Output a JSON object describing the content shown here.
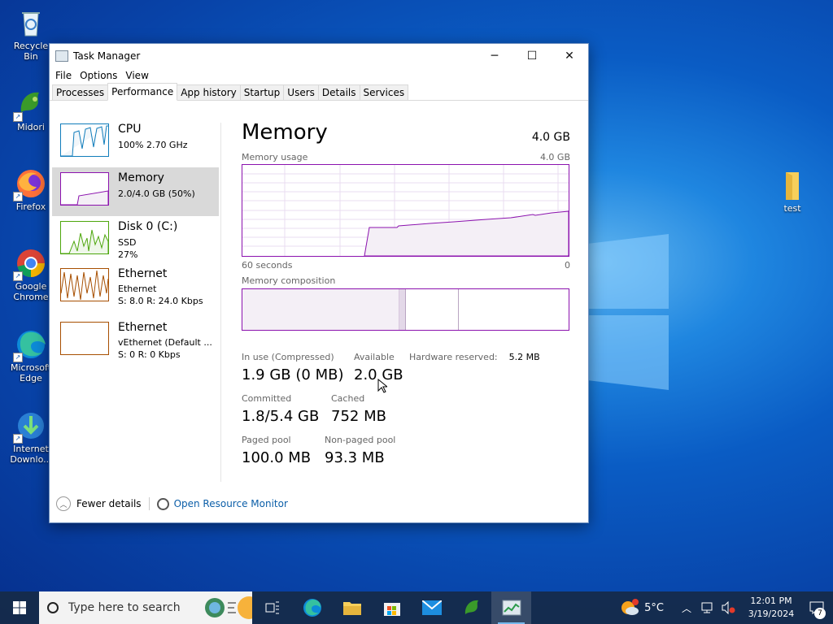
{
  "desktop": {
    "icons": [
      {
        "label": "Recycle Bin",
        "icon": "recycle-bin-icon"
      },
      {
        "label": "Midori",
        "icon": "midori-icon"
      },
      {
        "label": "Firefox",
        "icon": "firefox-icon"
      },
      {
        "label": "Google Chrome",
        "icon": "chrome-icon"
      },
      {
        "label": "Microsoft Edge",
        "icon": "edge-icon"
      },
      {
        "label": "Internet Downlo...",
        "icon": "idm-icon"
      }
    ],
    "folder": {
      "label": "test",
      "icon": "folder-icon"
    }
  },
  "window": {
    "title": "Task Manager",
    "menu": [
      "File",
      "Options",
      "View"
    ],
    "tabs": [
      "Processes",
      "Performance",
      "App history",
      "Startup",
      "Users",
      "Details",
      "Services"
    ],
    "active_tab": "Performance",
    "resources": [
      {
        "name": "CPU",
        "line1": "100%  2.70 GHz",
        "line2": "",
        "line3": "",
        "color": "#117dbb"
      },
      {
        "name": "Memory",
        "line1": "2.0/4.0 GB (50%)",
        "line2": "",
        "line3": "",
        "color": "#8b12ae"
      },
      {
        "name": "Disk 0 (C:)",
        "line1": "SSD",
        "line2": "27%",
        "line3": "",
        "color": "#4da60c"
      },
      {
        "name": "Ethernet",
        "line1": "Ethernet",
        "line2": "S: 8.0  R: 24.0 Kbps",
        "line3": "",
        "color": "#a74f01"
      },
      {
        "name": "Ethernet",
        "line1": "vEthernet (Default ...",
        "line2": "S: 0  R: 0 Kbps",
        "line3": "",
        "color": "#a74f01"
      }
    ],
    "memory": {
      "title": "Memory",
      "total": "4.0 GB",
      "usage_label": "Memory usage",
      "usage_max": "4.0 GB",
      "time_left": "60 seconds",
      "time_right": "0",
      "composition_label": "Memory composition",
      "in_use_label": "In use (Compressed)",
      "in_use_value": "1.9 GB (0 MB)",
      "available_label": "Available",
      "available_value": "2.0 GB",
      "hw_reserved_label": "Hardware reserved:",
      "hw_reserved_value": "5.2 MB",
      "committed_label": "Committed",
      "committed_value": "1.8/5.4 GB",
      "cached_label": "Cached",
      "cached_value": "752 MB",
      "paged_label": "Paged pool",
      "paged_value": "100.0 MB",
      "nonpaged_label": "Non-paged pool",
      "nonpaged_value": "93.3 MB"
    },
    "footer": {
      "fewer": "Fewer details",
      "monitor": "Open Resource Monitor"
    }
  },
  "taskbar": {
    "search_placeholder": "Type here to search",
    "weather": "5°C",
    "time": "12:01 PM",
    "date": "3/19/2024",
    "notifications": "7"
  }
}
